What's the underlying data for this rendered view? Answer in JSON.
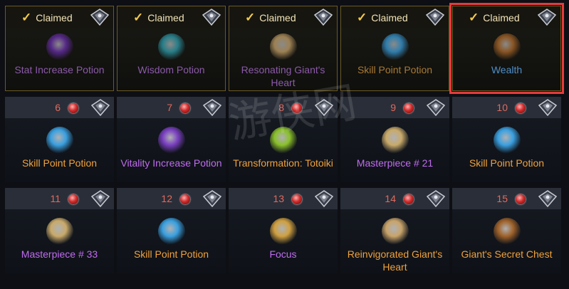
{
  "claimed_label": "Claimed",
  "rows": [
    [
      {
        "claimed": true,
        "label": "Stat Increase Potion",
        "color": "c-dimpurple",
        "icon": "potion-flask-icon",
        "iconColor": "#6b2fb0"
      },
      {
        "claimed": true,
        "label": "Wisdom Potion",
        "color": "c-dimpurple",
        "icon": "potion-bottle-icon",
        "iconColor": "#2ea0b0"
      },
      {
        "claimed": true,
        "label": "Resonating Giant's Heart",
        "color": "c-dimpurple",
        "icon": "scroll-icon",
        "iconColor": "#c9a46a"
      },
      {
        "claimed": true,
        "label": "Skill Point Potion",
        "color": "c-dimorange",
        "icon": "potion-flask-icon",
        "iconColor": "#3aa0e0"
      },
      {
        "claimed": true,
        "label": "Wealth",
        "color": "c-blue",
        "icon": "rune-icon",
        "iconColor": "#b06a2a",
        "highlight": true
      }
    ],
    [
      {
        "claimed": false,
        "num": "6",
        "label": "Skill Point Potion",
        "color": "c-orange",
        "icon": "potion-flask-icon",
        "iconColor": "#3aa0e0"
      },
      {
        "claimed": false,
        "num": "7",
        "label": "Vitality Increase Potion",
        "color": "c-purple",
        "icon": "potion-flask-icon",
        "iconColor": "#7a3fc0"
      },
      {
        "claimed": false,
        "num": "8",
        "label": "Transformation: Totoiki",
        "color": "c-orange",
        "icon": "cauldron-icon",
        "iconColor": "#8ac02a"
      },
      {
        "claimed": false,
        "num": "9",
        "label": "Masterpiece # 21",
        "color": "c-purple",
        "icon": "map-icon",
        "iconColor": "#c9aa6a"
      },
      {
        "claimed": false,
        "num": "10",
        "label": "Skill Point Potion",
        "color": "c-orange",
        "icon": "potion-flask-icon",
        "iconColor": "#3aa0e0"
      }
    ],
    [
      {
        "claimed": false,
        "num": "11",
        "label": "Masterpiece # 33",
        "color": "c-purple",
        "icon": "map-icon",
        "iconColor": "#c9aa6a"
      },
      {
        "claimed": false,
        "num": "12",
        "label": "Skill Point Potion",
        "color": "c-orange",
        "icon": "potion-flask-icon",
        "iconColor": "#3aa0e0"
      },
      {
        "claimed": false,
        "num": "13",
        "label": "Focus",
        "color": "c-purple",
        "icon": "rune-icon",
        "iconColor": "#d0a040"
      },
      {
        "claimed": false,
        "num": "14",
        "label": "Reinvigorated Giant's Heart",
        "color": "c-orange",
        "icon": "scroll-icon",
        "iconColor": "#c9a46a"
      },
      {
        "claimed": false,
        "num": "15",
        "label": "Giant's Secret Chest",
        "color": "c-orange",
        "icon": "chest-icon",
        "iconColor": "#a0622a"
      }
    ]
  ]
}
